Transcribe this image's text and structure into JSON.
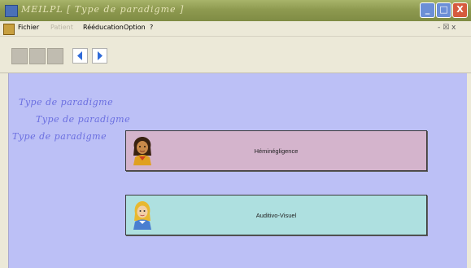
{
  "window": {
    "title": "MEILPL [ Type de paradigme ]",
    "controls": {
      "minimize": "_",
      "maximize": "□",
      "close": "X"
    }
  },
  "menubar": {
    "items": [
      {
        "label": "Fichier",
        "enabled": true
      },
      {
        "label": "Patient",
        "enabled": false
      },
      {
        "label": "Rééducation",
        "enabled": true
      },
      {
        "label": "Option",
        "enabled": true
      },
      {
        "label": "?",
        "enabled": true
      }
    ],
    "mdi_controls": "- ☒ x"
  },
  "toolbar": {
    "tools": [
      "document-icon",
      "folder-icon",
      "print-icon"
    ],
    "nav": [
      "back-arrow-icon",
      "forward-arrow-icon"
    ],
    "accent": "#2f6bd8"
  },
  "main": {
    "background": "#bcc0f6",
    "headings": [
      "Type de paradigme",
      "Type de paradigme",
      "Type de paradigme"
    ],
    "buttons": [
      {
        "label": "Héminégligence",
        "color": "#d4b4cc",
        "icon": "woman-avatar-icon"
      },
      {
        "label": "Auditivo-Visuel",
        "color": "#aee0e0",
        "icon": "blonde-avatar-icon"
      }
    ]
  }
}
